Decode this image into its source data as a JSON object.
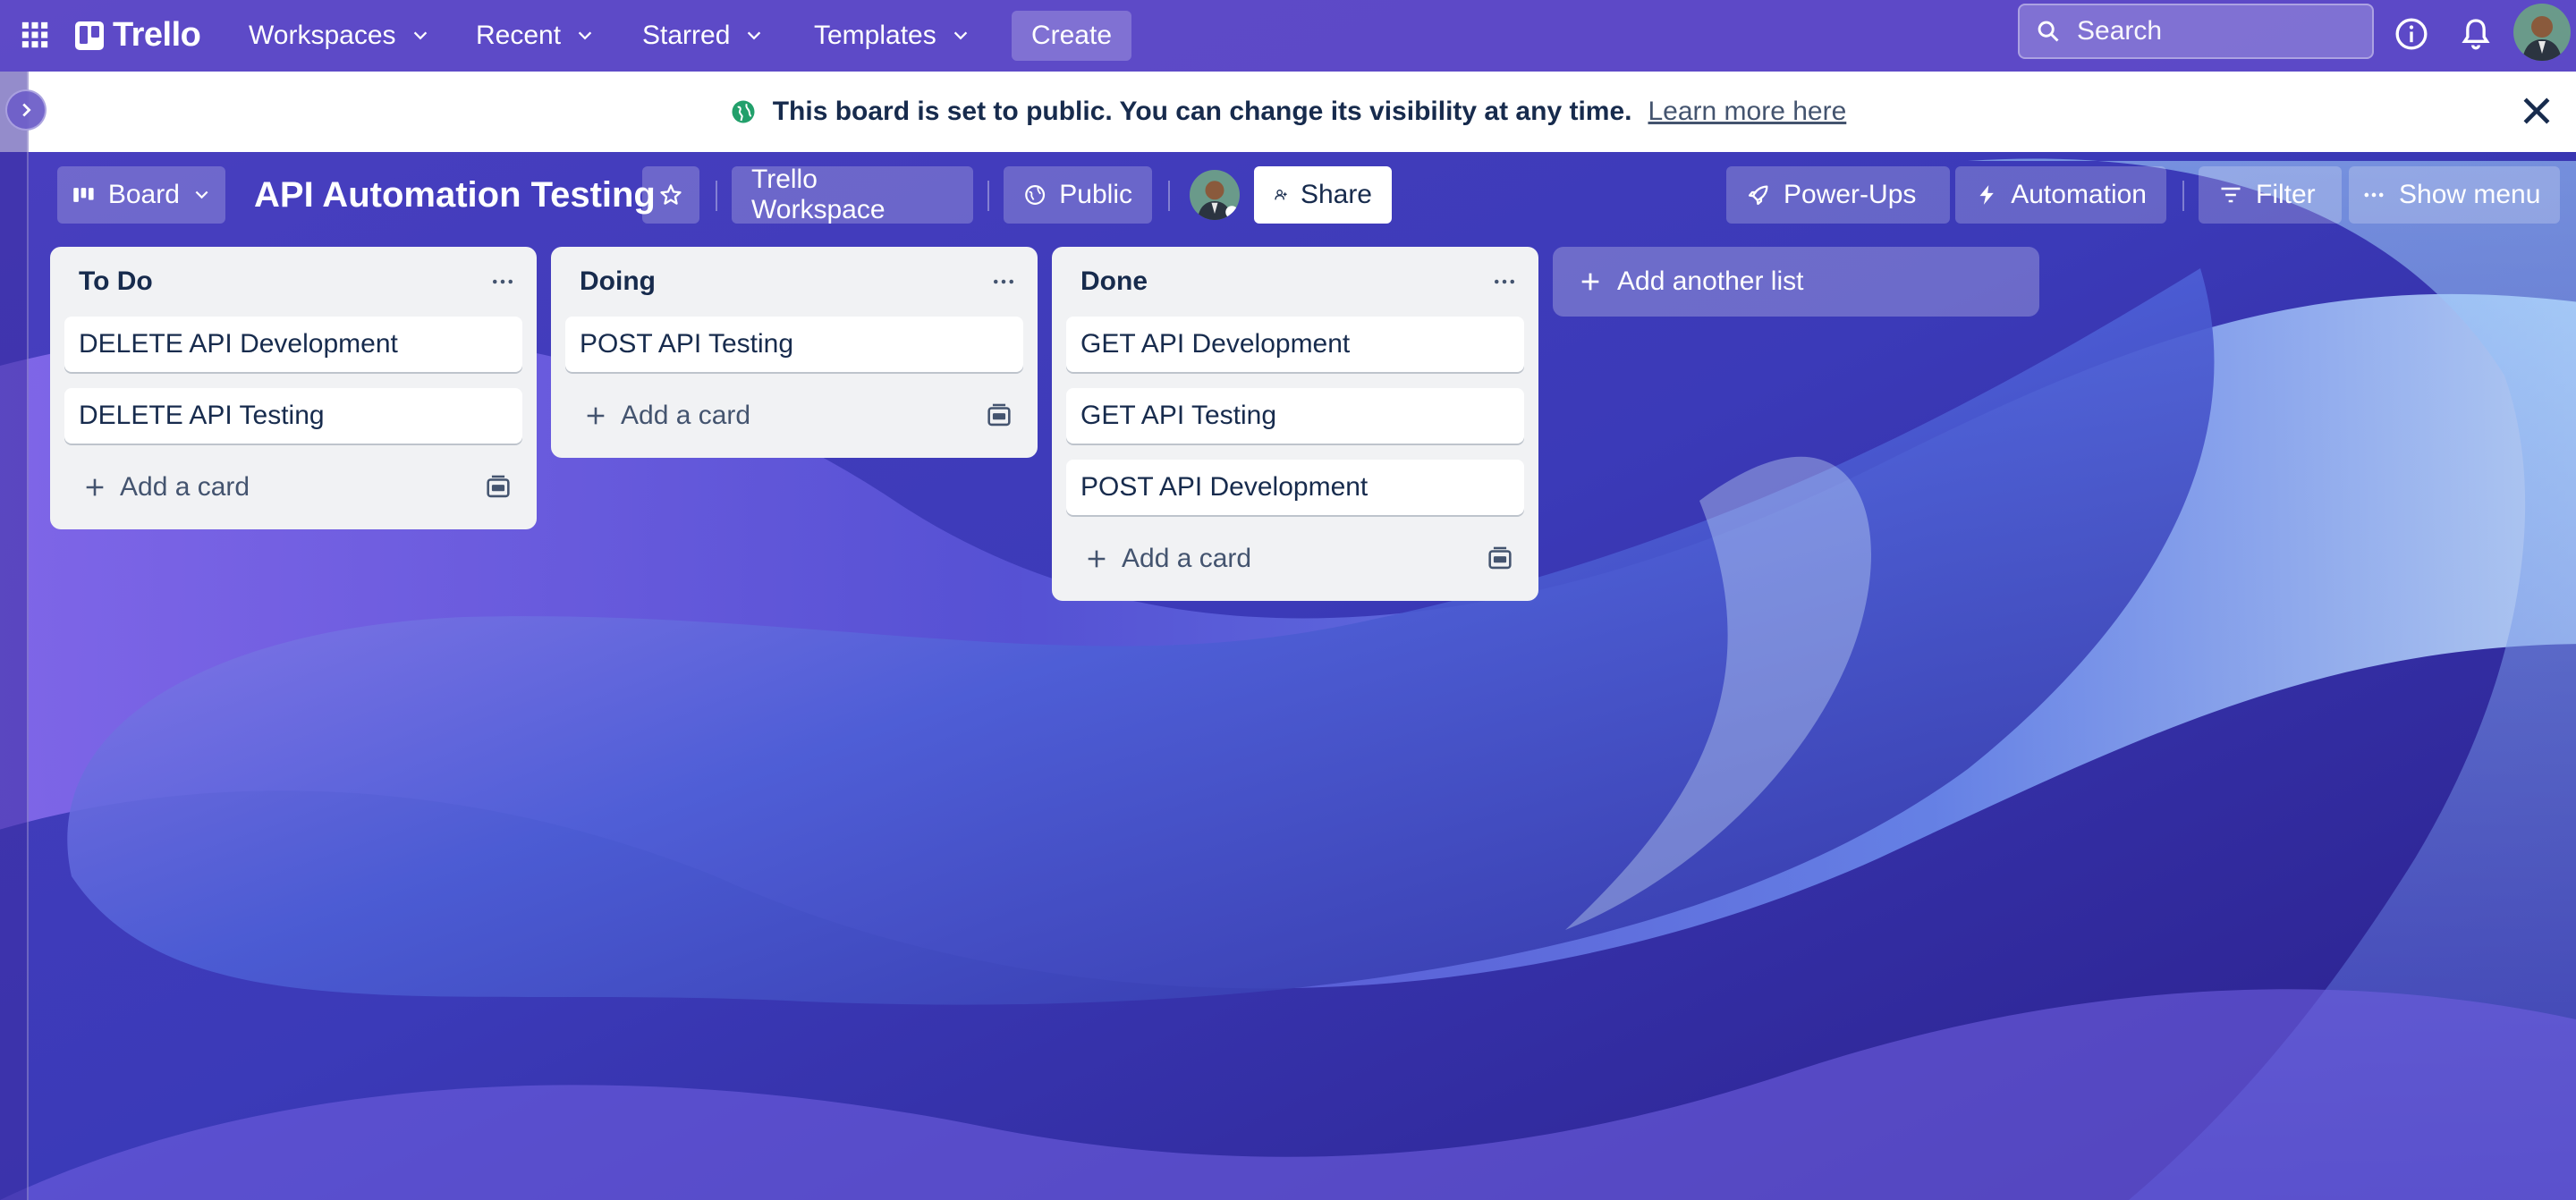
{
  "nav": {
    "logo_text": "Trello",
    "workspaces": "Workspaces",
    "recent": "Recent",
    "starred": "Starred",
    "templates": "Templates",
    "create": "Create",
    "search_placeholder": "Search"
  },
  "banner": {
    "message": "This board is set to public. You can change its visibility at any time.",
    "link": "Learn more here"
  },
  "board": {
    "view_label": "Board",
    "title": "API Automation Testing",
    "workspace": "Trello Workspace",
    "visibility": "Public",
    "share": "Share",
    "power_ups": "Power-Ups",
    "automation": "Automation",
    "filter": "Filter",
    "show_menu": "Show menu"
  },
  "lists": [
    {
      "title": "To Do",
      "cards": [
        "DELETE API Development",
        "DELETE API Testing"
      ],
      "add_card": "Add a card"
    },
    {
      "title": "Doing",
      "cards": [
        "POST API Testing"
      ],
      "add_card": "Add a card"
    },
    {
      "title": "Done",
      "cards": [
        "GET API Development",
        "GET API Testing",
        "POST API Development"
      ],
      "add_card": "Add a card"
    }
  ],
  "add_list": "Add another list",
  "colors": {
    "nav_bg": "#5f4bc8",
    "list_bg": "#f1f2f4",
    "public_green": "#22a06b",
    "text_dark": "#172b4d"
  },
  "icons": {
    "apps": "apps-grid-icon",
    "search": "search-icon",
    "info": "info-icon",
    "bell": "bell-icon",
    "star": "star-icon",
    "globe": "globe-icon",
    "close": "close-icon"
  }
}
